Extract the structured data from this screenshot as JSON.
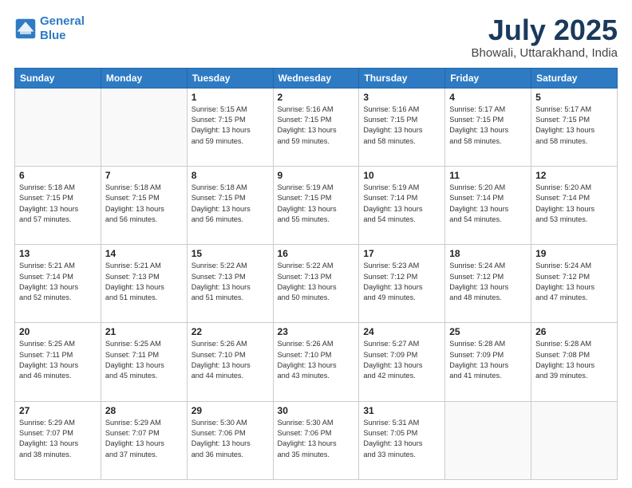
{
  "header": {
    "logo_line1": "General",
    "logo_line2": "Blue",
    "month": "July 2025",
    "location": "Bhowali, Uttarakhand, India"
  },
  "weekdays": [
    "Sunday",
    "Monday",
    "Tuesday",
    "Wednesday",
    "Thursday",
    "Friday",
    "Saturday"
  ],
  "weeks": [
    [
      {
        "day": "",
        "info": ""
      },
      {
        "day": "",
        "info": ""
      },
      {
        "day": "1",
        "info": "Sunrise: 5:15 AM\nSunset: 7:15 PM\nDaylight: 13 hours\nand 59 minutes."
      },
      {
        "day": "2",
        "info": "Sunrise: 5:16 AM\nSunset: 7:15 PM\nDaylight: 13 hours\nand 59 minutes."
      },
      {
        "day": "3",
        "info": "Sunrise: 5:16 AM\nSunset: 7:15 PM\nDaylight: 13 hours\nand 58 minutes."
      },
      {
        "day": "4",
        "info": "Sunrise: 5:17 AM\nSunset: 7:15 PM\nDaylight: 13 hours\nand 58 minutes."
      },
      {
        "day": "5",
        "info": "Sunrise: 5:17 AM\nSunset: 7:15 PM\nDaylight: 13 hours\nand 58 minutes."
      }
    ],
    [
      {
        "day": "6",
        "info": "Sunrise: 5:18 AM\nSunset: 7:15 PM\nDaylight: 13 hours\nand 57 minutes."
      },
      {
        "day": "7",
        "info": "Sunrise: 5:18 AM\nSunset: 7:15 PM\nDaylight: 13 hours\nand 56 minutes."
      },
      {
        "day": "8",
        "info": "Sunrise: 5:18 AM\nSunset: 7:15 PM\nDaylight: 13 hours\nand 56 minutes."
      },
      {
        "day": "9",
        "info": "Sunrise: 5:19 AM\nSunset: 7:15 PM\nDaylight: 13 hours\nand 55 minutes."
      },
      {
        "day": "10",
        "info": "Sunrise: 5:19 AM\nSunset: 7:14 PM\nDaylight: 13 hours\nand 54 minutes."
      },
      {
        "day": "11",
        "info": "Sunrise: 5:20 AM\nSunset: 7:14 PM\nDaylight: 13 hours\nand 54 minutes."
      },
      {
        "day": "12",
        "info": "Sunrise: 5:20 AM\nSunset: 7:14 PM\nDaylight: 13 hours\nand 53 minutes."
      }
    ],
    [
      {
        "day": "13",
        "info": "Sunrise: 5:21 AM\nSunset: 7:14 PM\nDaylight: 13 hours\nand 52 minutes."
      },
      {
        "day": "14",
        "info": "Sunrise: 5:21 AM\nSunset: 7:13 PM\nDaylight: 13 hours\nand 51 minutes."
      },
      {
        "day": "15",
        "info": "Sunrise: 5:22 AM\nSunset: 7:13 PM\nDaylight: 13 hours\nand 51 minutes."
      },
      {
        "day": "16",
        "info": "Sunrise: 5:22 AM\nSunset: 7:13 PM\nDaylight: 13 hours\nand 50 minutes."
      },
      {
        "day": "17",
        "info": "Sunrise: 5:23 AM\nSunset: 7:12 PM\nDaylight: 13 hours\nand 49 minutes."
      },
      {
        "day": "18",
        "info": "Sunrise: 5:24 AM\nSunset: 7:12 PM\nDaylight: 13 hours\nand 48 minutes."
      },
      {
        "day": "19",
        "info": "Sunrise: 5:24 AM\nSunset: 7:12 PM\nDaylight: 13 hours\nand 47 minutes."
      }
    ],
    [
      {
        "day": "20",
        "info": "Sunrise: 5:25 AM\nSunset: 7:11 PM\nDaylight: 13 hours\nand 46 minutes."
      },
      {
        "day": "21",
        "info": "Sunrise: 5:25 AM\nSunset: 7:11 PM\nDaylight: 13 hours\nand 45 minutes."
      },
      {
        "day": "22",
        "info": "Sunrise: 5:26 AM\nSunset: 7:10 PM\nDaylight: 13 hours\nand 44 minutes."
      },
      {
        "day": "23",
        "info": "Sunrise: 5:26 AM\nSunset: 7:10 PM\nDaylight: 13 hours\nand 43 minutes."
      },
      {
        "day": "24",
        "info": "Sunrise: 5:27 AM\nSunset: 7:09 PM\nDaylight: 13 hours\nand 42 minutes."
      },
      {
        "day": "25",
        "info": "Sunrise: 5:28 AM\nSunset: 7:09 PM\nDaylight: 13 hours\nand 41 minutes."
      },
      {
        "day": "26",
        "info": "Sunrise: 5:28 AM\nSunset: 7:08 PM\nDaylight: 13 hours\nand 39 minutes."
      }
    ],
    [
      {
        "day": "27",
        "info": "Sunrise: 5:29 AM\nSunset: 7:07 PM\nDaylight: 13 hours\nand 38 minutes."
      },
      {
        "day": "28",
        "info": "Sunrise: 5:29 AM\nSunset: 7:07 PM\nDaylight: 13 hours\nand 37 minutes."
      },
      {
        "day": "29",
        "info": "Sunrise: 5:30 AM\nSunset: 7:06 PM\nDaylight: 13 hours\nand 36 minutes."
      },
      {
        "day": "30",
        "info": "Sunrise: 5:30 AM\nSunset: 7:06 PM\nDaylight: 13 hours\nand 35 minutes."
      },
      {
        "day": "31",
        "info": "Sunrise: 5:31 AM\nSunset: 7:05 PM\nDaylight: 13 hours\nand 33 minutes."
      },
      {
        "day": "",
        "info": ""
      },
      {
        "day": "",
        "info": ""
      }
    ]
  ]
}
